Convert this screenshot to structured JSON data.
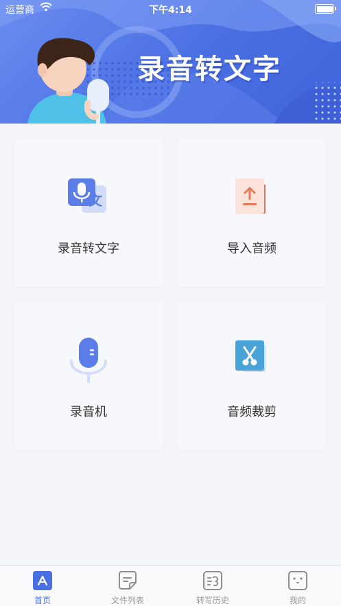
{
  "status_bar": {
    "carrier": "运营商",
    "time": "下午4:14"
  },
  "banner": {
    "title": "录音转文字"
  },
  "cards": [
    {
      "label": "录音转文字",
      "icon": "voice-to-text-icon"
    },
    {
      "label": "导入音频",
      "icon": "import-audio-icon"
    },
    {
      "label": "录音机",
      "icon": "microphone-icon"
    },
    {
      "label": "音频裁剪",
      "icon": "scissors-icon"
    }
  ],
  "tabs": [
    {
      "label": "首页",
      "icon": "home-icon",
      "active": true
    },
    {
      "label": "文件列表",
      "icon": "file-list-icon",
      "active": false
    },
    {
      "label": "转写历史",
      "icon": "history-icon",
      "active": false
    },
    {
      "label": "我的",
      "icon": "profile-icon",
      "active": false
    }
  ],
  "colors": {
    "accent": "#4a6fe3",
    "card_bg": "#f7f8fb",
    "page_bg": "#f3f5f9",
    "import_orange": "#e6795a",
    "scissors_blue": "#4aa3d8"
  }
}
